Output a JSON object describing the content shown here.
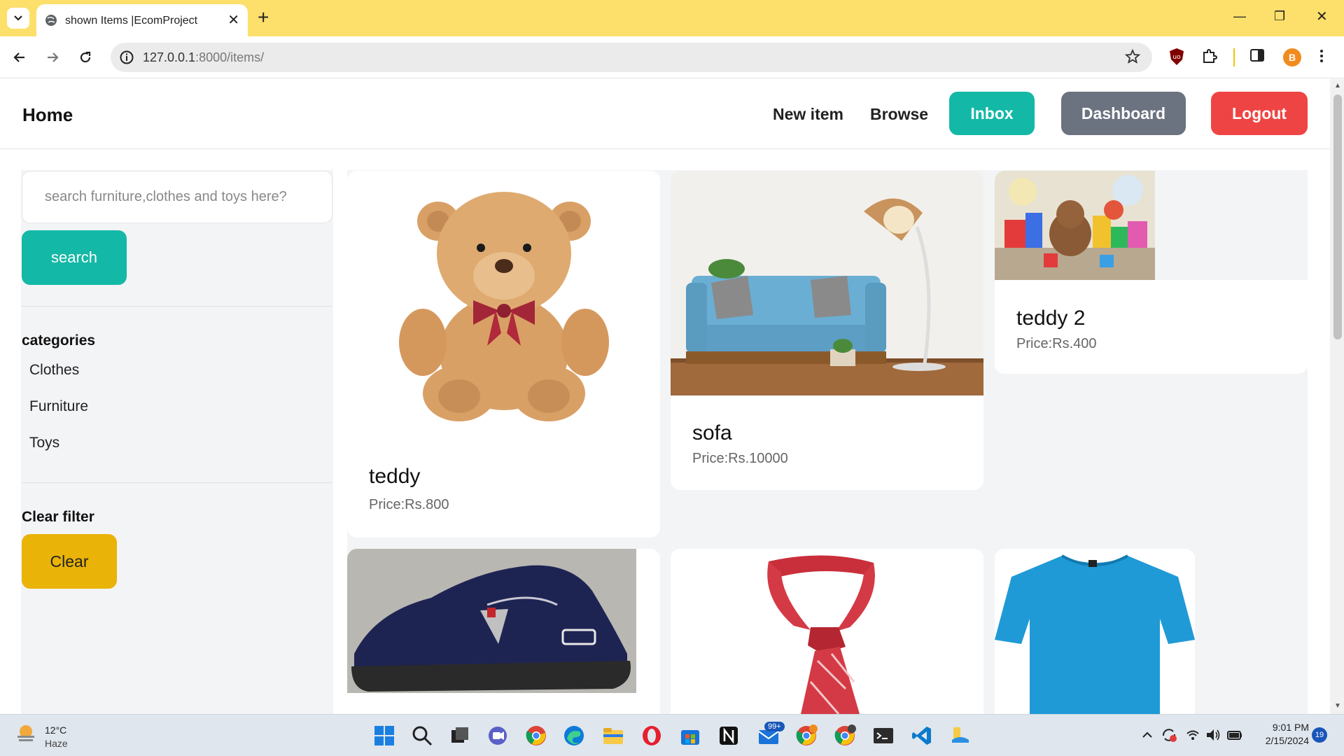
{
  "browser": {
    "tab_title": "shown Items |EcomProject",
    "url_host": "127.0.0.1",
    "url_rest": ":8000/items/",
    "tab_color": "#fde06b"
  },
  "nav": {
    "home": "Home",
    "new_item": "New item",
    "browse": "Browse",
    "inbox": "Inbox",
    "dashboard": "Dashboard",
    "logout": "Logout"
  },
  "sidebar": {
    "search_placeholder": "search furniture,clothes and toys here?",
    "search_button": "search",
    "categories_heading": "categories",
    "categories": [
      "Clothes",
      "Furniture",
      "Toys"
    ],
    "clear_heading": "Clear filter",
    "clear_button": "Clear"
  },
  "items": [
    {
      "name": "teddy",
      "price": "Price:Rs.800"
    },
    {
      "name": "sofa",
      "price": "Price:Rs.10000"
    },
    {
      "name": "teddy 2",
      "price": "Price:Rs.400"
    }
  ],
  "colors": {
    "inbox": "#14b8a6",
    "dashboard": "#6b7280",
    "logout": "#ef4444",
    "clear": "#eab308"
  },
  "taskbar": {
    "temperature": "12°C",
    "condition": "Haze",
    "time": "9:01 PM",
    "date": "2/15/2024",
    "notifications": "19",
    "mail_badge": "99+"
  }
}
